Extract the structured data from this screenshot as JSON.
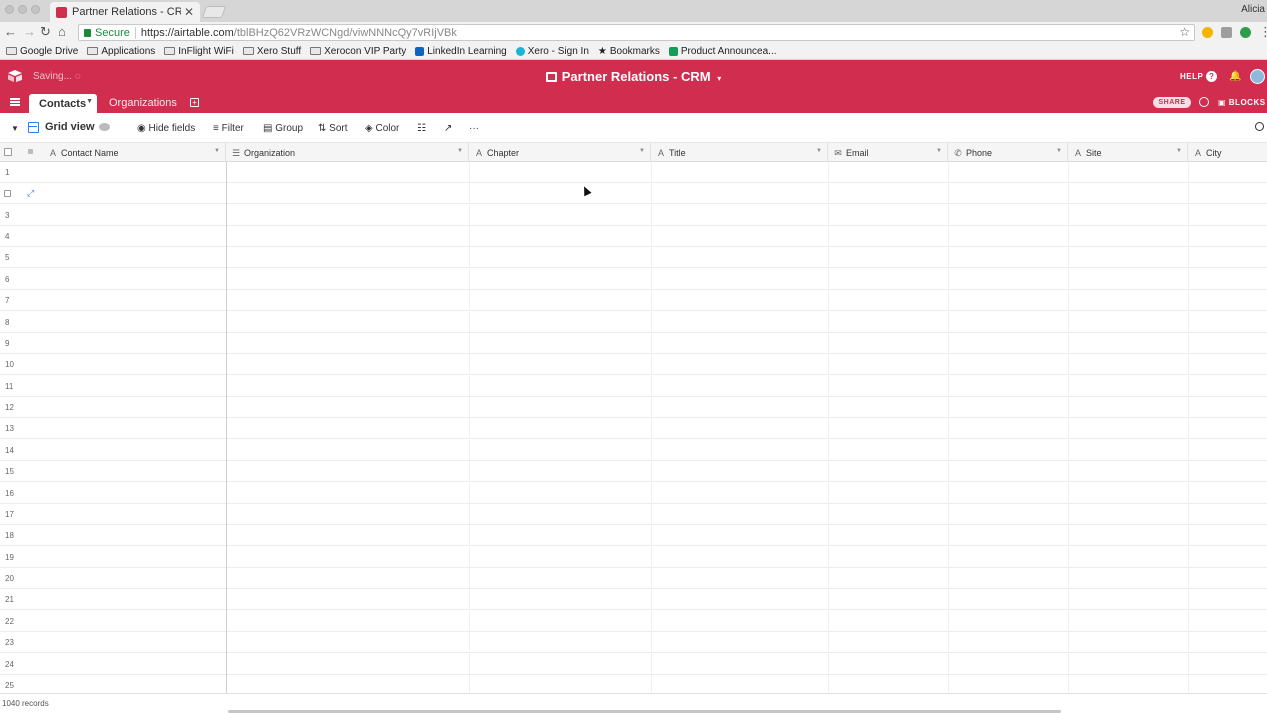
{
  "browser": {
    "tab_title": "Partner Relations - CRM: Cont",
    "profile_name": "Alicia",
    "secure_label": "Secure",
    "url_host": "https://airtable.com",
    "url_path": "/tblBHzQ62VRzWCNgd/viwNNNcQy7vRIjVBk",
    "bookmarks": [
      "Google Drive",
      "Applications",
      "InFlight WiFi",
      "Xero Stuff",
      "Xerocon VIP Party",
      "LinkedIn Learning",
      "Xero - Sign In",
      "Bookmarks",
      "Product Announcea..."
    ]
  },
  "app": {
    "brand_color": "#d02d4f",
    "saving_status": "Saving...",
    "base_title": "Partner Relations - CRM",
    "help_label": "HELP",
    "share_label": "SHARE",
    "blocks_label": "BLOCKS",
    "tables": [
      "Contacts",
      "Organizations"
    ]
  },
  "view": {
    "name": "Grid view",
    "toolbar": {
      "hide_fields": "Hide fields",
      "filter": "Filter",
      "group": "Group",
      "sort": "Sort",
      "color": "Color"
    }
  },
  "grid": {
    "columns": [
      {
        "name": "Contact Name",
        "icon": "A"
      },
      {
        "name": "Organization",
        "icon": "☰"
      },
      {
        "name": "Chapter",
        "icon": "A"
      },
      {
        "name": "Title",
        "icon": "A"
      },
      {
        "name": "Email",
        "icon": "✉"
      },
      {
        "name": "Phone",
        "icon": "✆"
      },
      {
        "name": "Site",
        "icon": "A"
      },
      {
        "name": "City",
        "icon": "A"
      }
    ],
    "row_numbers": [
      "1",
      "",
      "3",
      "4",
      "5",
      "6",
      "7",
      "8",
      "9",
      "10",
      "11",
      "12",
      "13",
      "14",
      "15",
      "16",
      "17",
      "18",
      "19",
      "20",
      "21",
      "22",
      "23",
      "24",
      "25"
    ],
    "record_count": "1040 records"
  }
}
